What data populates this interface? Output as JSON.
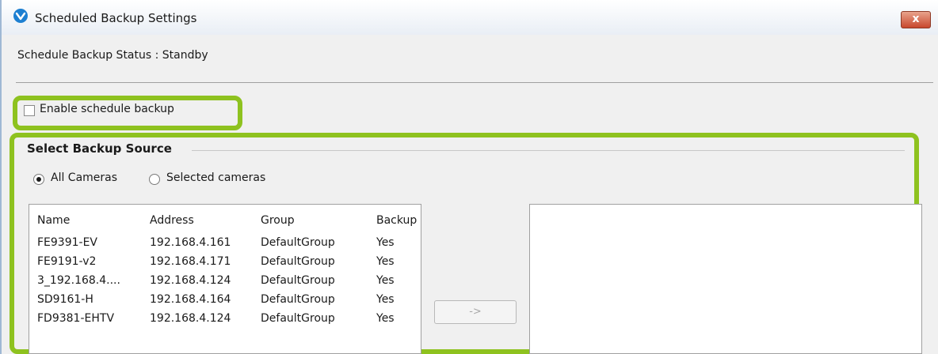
{
  "window": {
    "title": "Scheduled Backup Settings",
    "close_symbol": "x"
  },
  "status": {
    "text": "Schedule Backup Status : Standby"
  },
  "enable": {
    "label": "Enable schedule backup",
    "checked": false
  },
  "source": {
    "title": "Select Backup Source",
    "options": [
      {
        "label": "All Cameras",
        "selected": true
      },
      {
        "label": "Selected cameras",
        "selected": false
      }
    ],
    "columns": [
      "Name",
      "Address",
      "Group",
      "Backup"
    ],
    "rows": [
      [
        "FE9391-EV",
        "192.168.4.161",
        "DefaultGroup",
        "Yes"
      ],
      [
        "FE9191-v2",
        "192.168.4.171",
        "DefaultGroup",
        "Yes"
      ],
      [
        "3_192.168.4....",
        "192.168.4.124",
        "DefaultGroup",
        "Yes"
      ],
      [
        "SD9161-H",
        "192.168.4.164",
        "DefaultGroup",
        "Yes"
      ],
      [
        "FD9381-EHTV",
        "192.168.4.124",
        "DefaultGroup",
        "Yes"
      ]
    ],
    "move_button": "->"
  },
  "colors": {
    "highlight": "#8ec21f",
    "close_button": "#c8482d"
  }
}
